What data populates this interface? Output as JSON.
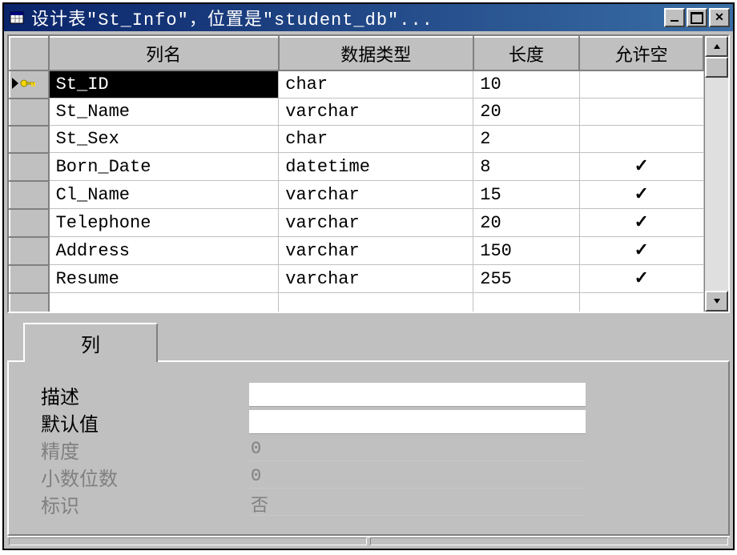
{
  "title": "设计表\"St_Info\"，位置是\"student_db\"...",
  "columns_header": {
    "name": "列名",
    "type": "数据类型",
    "length": "长度",
    "allow_null": "允许空"
  },
  "columns": [
    {
      "name": "St_ID",
      "type": "char",
      "length": "10",
      "allow_null": false,
      "pk": true,
      "selected": true
    },
    {
      "name": "St_Name",
      "type": "varchar",
      "length": "20",
      "allow_null": false,
      "pk": false,
      "selected": false
    },
    {
      "name": "St_Sex",
      "type": "char",
      "length": "2",
      "allow_null": false,
      "pk": false,
      "selected": false
    },
    {
      "name": "Born_Date",
      "type": "datetime",
      "length": "8",
      "allow_null": true,
      "pk": false,
      "selected": false
    },
    {
      "name": "Cl_Name",
      "type": "varchar",
      "length": "15",
      "allow_null": true,
      "pk": false,
      "selected": false
    },
    {
      "name": "Telephone",
      "type": "varchar",
      "length": "20",
      "allow_null": true,
      "pk": false,
      "selected": false
    },
    {
      "name": "Address",
      "type": "varchar",
      "length": "150",
      "allow_null": true,
      "pk": false,
      "selected": false
    },
    {
      "name": "Resume",
      "type": "varchar",
      "length": "255",
      "allow_null": true,
      "pk": false,
      "selected": false
    }
  ],
  "tab_label": "列",
  "props": {
    "description": {
      "label": "描述",
      "value": "",
      "enabled": true
    },
    "default": {
      "label": "默认值",
      "value": "",
      "enabled": true
    },
    "precision": {
      "label": "精度",
      "value": "0",
      "enabled": false
    },
    "scale": {
      "label": "小数位数",
      "value": "0",
      "enabled": false
    },
    "identity": {
      "label": "标识",
      "value": "否",
      "enabled": false
    }
  }
}
